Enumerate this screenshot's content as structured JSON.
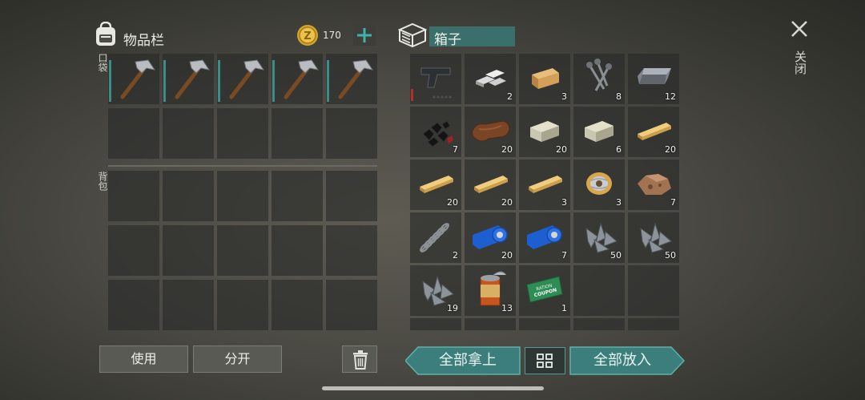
{
  "inventory": {
    "title": "物品栏",
    "coins": "170",
    "pocket_label": "口袋",
    "backpack_label": "背包"
  },
  "box": {
    "title": "箱子",
    "items": [
      {
        "name": "pistol",
        "count": ""
      },
      {
        "name": "metal-bars",
        "count": "2"
      },
      {
        "name": "wood-block",
        "count": "3"
      },
      {
        "name": "nails",
        "count": "8"
      },
      {
        "name": "iron-ingot",
        "count": "12"
      },
      {
        "name": "coal",
        "count": "7"
      },
      {
        "name": "leather",
        "count": "20"
      },
      {
        "name": "stone",
        "count": "20"
      },
      {
        "name": "stone",
        "count": "6"
      },
      {
        "name": "plank",
        "count": "20"
      },
      {
        "name": "plank",
        "count": "20"
      },
      {
        "name": "plank",
        "count": "20"
      },
      {
        "name": "plank",
        "count": "3"
      },
      {
        "name": "wire-spool",
        "count": "3"
      },
      {
        "name": "ore",
        "count": "7"
      },
      {
        "name": "spring",
        "count": "2"
      },
      {
        "name": "tape",
        "count": "20"
      },
      {
        "name": "tape",
        "count": "7"
      },
      {
        "name": "scrap-metal",
        "count": "50"
      },
      {
        "name": "scrap-metal",
        "count": "50"
      },
      {
        "name": "scrap-metal",
        "count": "19"
      },
      {
        "name": "canned-food",
        "count": "13"
      },
      {
        "name": "ration-coupon",
        "count": "1"
      }
    ]
  },
  "coupon_text": {
    "line1": "RATION",
    "line2": "COUPON"
  },
  "actions": {
    "use": "使用",
    "split": "分开",
    "take_all": "全部拿上",
    "put_all": "全部放入"
  },
  "close_label": "关闭"
}
